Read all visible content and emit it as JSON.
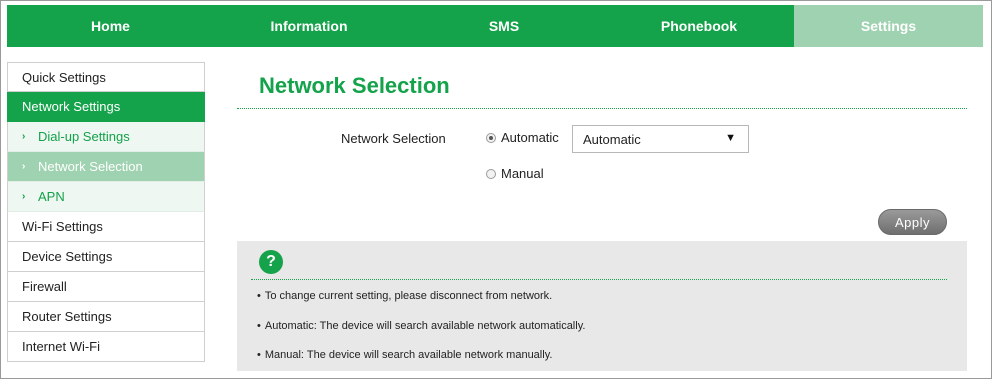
{
  "nav": {
    "tabs": [
      {
        "label": "Home"
      },
      {
        "label": "Information"
      },
      {
        "label": "SMS"
      },
      {
        "label": "Phonebook"
      },
      {
        "label": "Settings"
      }
    ],
    "active_tab": "Settings"
  },
  "sidebar": {
    "items": [
      {
        "label": "Quick Settings"
      },
      {
        "label": "Network Settings"
      },
      {
        "label": "Dial-up Settings"
      },
      {
        "label": "Network Selection"
      },
      {
        "label": "APN"
      },
      {
        "label": "Wi-Fi Settings"
      },
      {
        "label": "Device Settings"
      },
      {
        "label": "Firewall"
      },
      {
        "label": "Router Settings"
      },
      {
        "label": "Internet Wi-Fi"
      }
    ],
    "sub_chevron": "›"
  },
  "main": {
    "title": "Network Selection",
    "field_label": "Network Selection",
    "radio_automatic": "Automatic",
    "radio_manual": "Manual",
    "selected_mode": "Automatic",
    "select_value": "Automatic",
    "select_caret": "▼",
    "apply_label": "Apply"
  },
  "help": {
    "icon_glyph": "?",
    "bullet": "•",
    "lines": [
      "To change current setting, please disconnect from network.",
      "Automatic: The device will search available network automatically.",
      "Manual: The device will search available network manually."
    ]
  },
  "colors": {
    "brand_green": "#14a24a",
    "active_tab": "#9fd2b1",
    "apply_button": "#7f7f7f",
    "help_panel": "#e8e8e8"
  },
  "icons": {
    "help": "help-icon",
    "chevron": "chevron-right-icon",
    "dropdown": "caret-down-icon"
  }
}
